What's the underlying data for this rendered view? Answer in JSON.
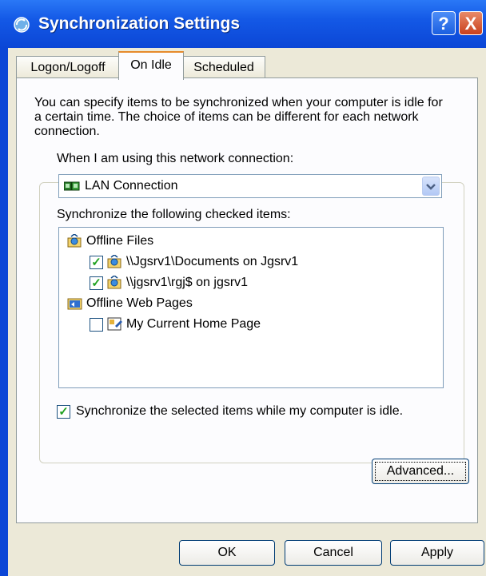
{
  "window": {
    "title": "Synchronization Settings",
    "help_label": "?",
    "close_label": "X"
  },
  "tabs": [
    {
      "label": "Logon/Logoff"
    },
    {
      "label": "On Idle"
    },
    {
      "label": "Scheduled"
    }
  ],
  "description": "You can specify items to be synchronized when your computer is idle for a certain time.  The choice of items can be different for each network connection.",
  "connection": {
    "label": "When I am using this network connection:",
    "selected": "LAN Connection"
  },
  "sync_list": {
    "label": "Synchronize the following checked items:",
    "items": [
      {
        "text": "Offline Files",
        "type": "group"
      },
      {
        "text": "\\\\Jgsrv1\\Documents on Jgsrv1",
        "checked": true
      },
      {
        "text": "\\\\jgsrv1\\rgj$ on jgsrv1",
        "checked": true
      },
      {
        "text": "Offline Web Pages",
        "type": "group"
      },
      {
        "text": "My Current Home Page",
        "checked": false
      }
    ]
  },
  "idle_option": {
    "text": "Synchronize the selected items while my computer is idle.",
    "checked": true
  },
  "buttons": {
    "advanced": "Advanced...",
    "ok": "OK",
    "cancel": "Cancel",
    "apply": "Apply"
  }
}
